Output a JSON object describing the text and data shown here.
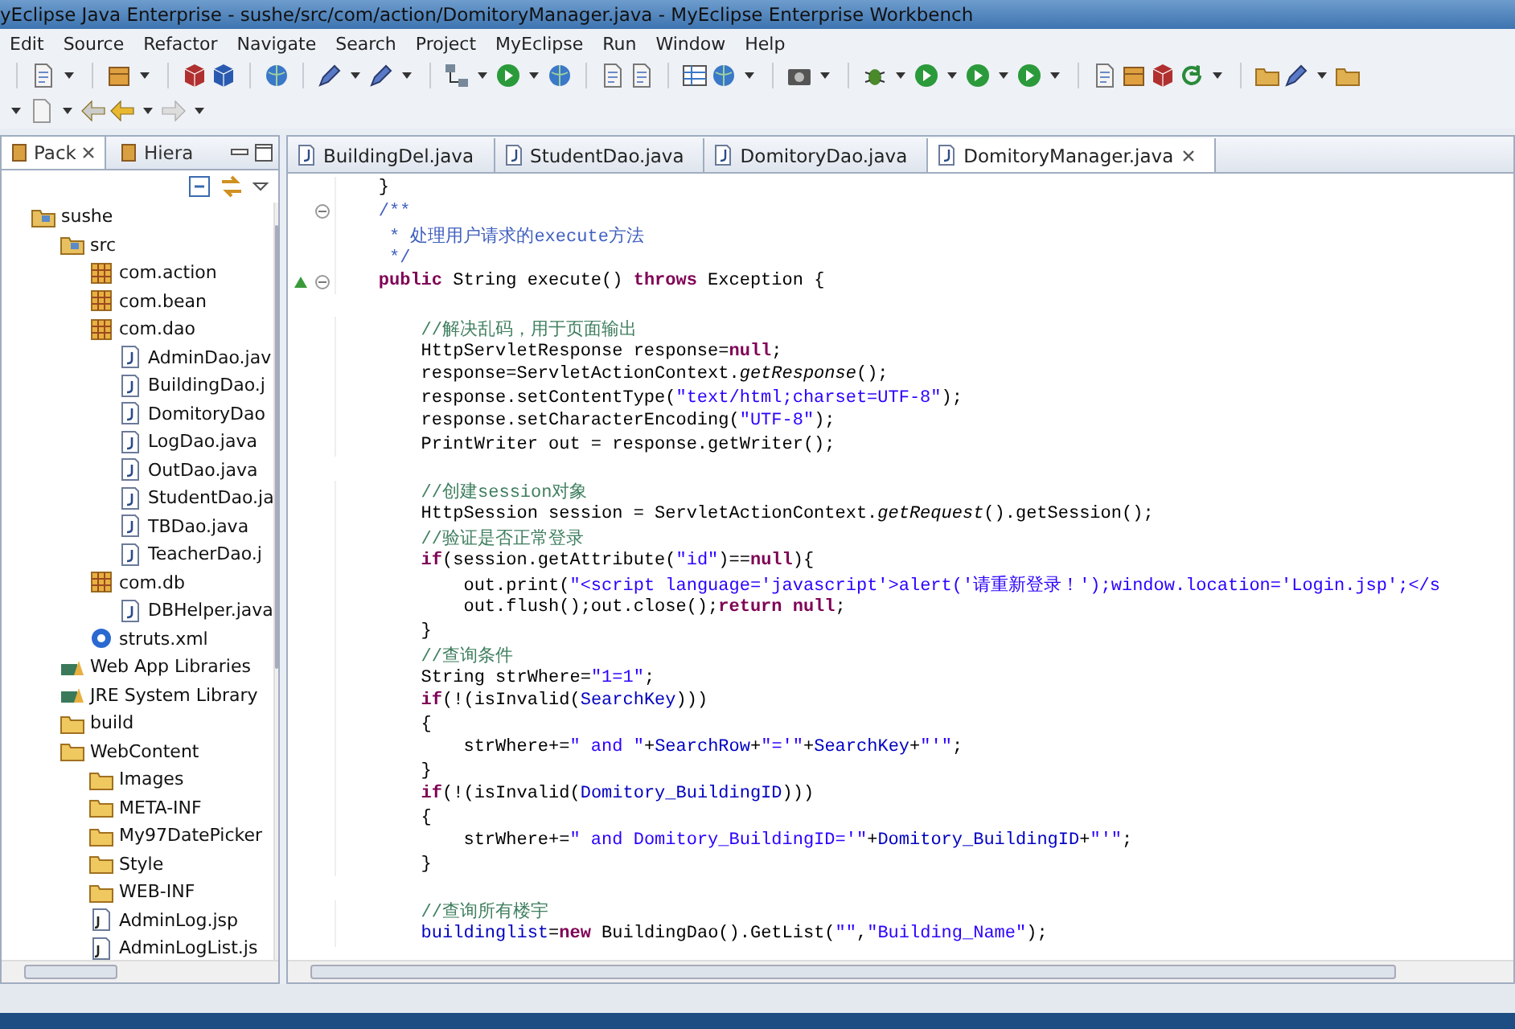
{
  "window": {
    "title": "yEclipse Java Enterprise - sushe/src/com/action/DomitoryManager.java - MyEclipse Enterprise Workbench"
  },
  "menu": [
    "Edit",
    "Source",
    "Refactor",
    "Navigate",
    "Search",
    "Project",
    "MyEclipse",
    "Run",
    "Window",
    "Help"
  ],
  "side_panel": {
    "tabs": [
      {
        "label": "Pack",
        "selected": true
      },
      {
        "label": "Hiera",
        "selected": false
      }
    ],
    "tree": [
      {
        "label": "sushe",
        "kind": "project",
        "children": [
          {
            "label": "src",
            "kind": "srcfolder",
            "children": [
              {
                "label": "com.action",
                "kind": "package"
              },
              {
                "label": "com.bean",
                "kind": "package"
              },
              {
                "label": "com.dao",
                "kind": "package",
                "children": [
                  {
                    "label": "AdminDao.jav",
                    "kind": "java"
                  },
                  {
                    "label": "BuildingDao.j",
                    "kind": "java"
                  },
                  {
                    "label": "DomitoryDao",
                    "kind": "java"
                  },
                  {
                    "label": "LogDao.java",
                    "kind": "java"
                  },
                  {
                    "label": "OutDao.java",
                    "kind": "java"
                  },
                  {
                    "label": "StudentDao.ja",
                    "kind": "java"
                  },
                  {
                    "label": "TBDao.java",
                    "kind": "java"
                  },
                  {
                    "label": "TeacherDao.j",
                    "kind": "java"
                  }
                ]
              },
              {
                "label": "com.db",
                "kind": "package",
                "children": [
                  {
                    "label": "DBHelper.java",
                    "kind": "java"
                  }
                ]
              },
              {
                "label": "struts.xml",
                "kind": "xml"
              }
            ]
          },
          {
            "label": "Web App Libraries",
            "kind": "library"
          },
          {
            "label": "JRE System Library",
            "kind": "library"
          },
          {
            "label": "build",
            "kind": "folder"
          },
          {
            "label": "WebContent",
            "kind": "folder",
            "children": [
              {
                "label": "Images",
                "kind": "folder"
              },
              {
                "label": "META-INF",
                "kind": "folder"
              },
              {
                "label": "My97DatePicker",
                "kind": "folder"
              },
              {
                "label": "Style",
                "kind": "folder"
              },
              {
                "label": "WEB-INF",
                "kind": "folder"
              },
              {
                "label": "AdminLog.jsp",
                "kind": "jsp"
              },
              {
                "label": "AdminLogList.js",
                "kind": "jsp"
              }
            ]
          }
        ]
      }
    ]
  },
  "editor": {
    "tabs": [
      {
        "label": "BuildingDel.java",
        "selected": false
      },
      {
        "label": "StudentDao.java",
        "selected": false
      },
      {
        "label": "DomitoryDao.java",
        "selected": false
      },
      {
        "label": "DomitoryManager.java",
        "selected": true
      }
    ],
    "lines": [
      {
        "tokens": [
          {
            "kind": "plain",
            "text": "    }"
          }
        ]
      },
      {
        "fold": true,
        "tokens": [
          {
            "kind": "doc",
            "text": "    /**"
          }
        ]
      },
      {
        "tokens": [
          {
            "kind": "doc",
            "text": "     * 处理用户请求的execute方法"
          }
        ]
      },
      {
        "tokens": [
          {
            "kind": "doc",
            "text": "     */"
          }
        ]
      },
      {
        "fold": true,
        "override": true,
        "tokens": [
          {
            "kind": "kw",
            "text": "    public"
          },
          {
            "kind": "plain",
            "text": " String execute() "
          },
          {
            "kind": "kw",
            "text": "throws"
          },
          {
            "kind": "plain",
            "text": " Exception {"
          }
        ]
      },
      {
        "gap_before": true,
        "tokens": [
          {
            "kind": "cm",
            "text": "        //解决乱码，用于页面输出"
          }
        ]
      },
      {
        "tokens": [
          {
            "kind": "plain",
            "text": "        HttpServletResponse response="
          },
          {
            "kind": "kw",
            "text": "null"
          },
          {
            "kind": "plain",
            "text": ";"
          }
        ]
      },
      {
        "tokens": [
          {
            "kind": "plain",
            "text": "        response=ServletActionContext."
          },
          {
            "kind": "it",
            "text": "getResponse"
          },
          {
            "kind": "plain",
            "text": "();"
          }
        ]
      },
      {
        "tokens": [
          {
            "kind": "plain",
            "text": "        response.setContentType("
          },
          {
            "kind": "str",
            "text": "\"text/html;charset=UTF-8\""
          },
          {
            "kind": "plain",
            "text": ");"
          }
        ]
      },
      {
        "tokens": [
          {
            "kind": "plain",
            "text": "        response.setCharacterEncoding("
          },
          {
            "kind": "str",
            "text": "\"UTF-8\""
          },
          {
            "kind": "plain",
            "text": ");"
          }
        ]
      },
      {
        "tokens": [
          {
            "kind": "plain",
            "text": "        PrintWriter out = response.getWriter();"
          }
        ]
      },
      {
        "gap_before": true,
        "tokens": [
          {
            "kind": "cm",
            "text": "        //创建session对象"
          }
        ]
      },
      {
        "tokens": [
          {
            "kind": "plain",
            "text": "        HttpSession session = ServletActionContext."
          },
          {
            "kind": "it",
            "text": "getRequest"
          },
          {
            "kind": "plain",
            "text": "().getSession();"
          }
        ]
      },
      {
        "tokens": [
          {
            "kind": "cm",
            "text": "        //验证是否正常登录"
          }
        ]
      },
      {
        "tokens": [
          {
            "kind": "kw",
            "text": "        if"
          },
          {
            "kind": "plain",
            "text": "(session.getAttribute("
          },
          {
            "kind": "str",
            "text": "\"id\""
          },
          {
            "kind": "plain",
            "text": ")=="
          },
          {
            "kind": "kw",
            "text": "null"
          },
          {
            "kind": "plain",
            "text": "){"
          }
        ]
      },
      {
        "tokens": [
          {
            "kind": "plain",
            "text": "            out.print("
          },
          {
            "kind": "str",
            "text": "\"<script language='javascript'>alert('请重新登录！');window.location='Login.jsp';</s"
          }
        ]
      },
      {
        "tokens": [
          {
            "kind": "plain",
            "text": "            out.flush();out.close();"
          },
          {
            "kind": "kw",
            "text": "return null"
          },
          {
            "kind": "plain",
            "text": ";"
          }
        ]
      },
      {
        "tokens": [
          {
            "kind": "plain",
            "text": "        }"
          }
        ]
      },
      {
        "tokens": [
          {
            "kind": "cm",
            "text": "        //查询条件"
          }
        ]
      },
      {
        "tokens": [
          {
            "kind": "plain",
            "text": "        String strWhere="
          },
          {
            "kind": "str",
            "text": "\"1=1\""
          },
          {
            "kind": "plain",
            "text": ";"
          }
        ]
      },
      {
        "tokens": [
          {
            "kind": "kw",
            "text": "        if"
          },
          {
            "kind": "plain",
            "text": "(!(isInvalid("
          },
          {
            "kind": "field",
            "text": "SearchKey"
          },
          {
            "kind": "plain",
            "text": ")))"
          }
        ]
      },
      {
        "tokens": [
          {
            "kind": "plain",
            "text": "        {"
          }
        ]
      },
      {
        "tokens": [
          {
            "kind": "plain",
            "text": "            strWhere+="
          },
          {
            "kind": "str",
            "text": "\" and \""
          },
          {
            "kind": "plain",
            "text": "+"
          },
          {
            "kind": "field",
            "text": "SearchRow"
          },
          {
            "kind": "plain",
            "text": "+"
          },
          {
            "kind": "str",
            "text": "\"='\""
          },
          {
            "kind": "plain",
            "text": "+"
          },
          {
            "kind": "field",
            "text": "SearchKey"
          },
          {
            "kind": "plain",
            "text": "+"
          },
          {
            "kind": "str",
            "text": "\"'\""
          },
          {
            "kind": "plain",
            "text": ";"
          }
        ]
      },
      {
        "tokens": [
          {
            "kind": "plain",
            "text": "        }"
          }
        ]
      },
      {
        "tokens": [
          {
            "kind": "kw",
            "text": "        if"
          },
          {
            "kind": "plain",
            "text": "(!(isInvalid("
          },
          {
            "kind": "field",
            "text": "Domitory_BuildingID"
          },
          {
            "kind": "plain",
            "text": ")))"
          }
        ]
      },
      {
        "tokens": [
          {
            "kind": "plain",
            "text": "        {"
          }
        ]
      },
      {
        "tokens": [
          {
            "kind": "plain",
            "text": "            strWhere+="
          },
          {
            "kind": "str",
            "text": "\" and Domitory_BuildingID='\""
          },
          {
            "kind": "plain",
            "text": "+"
          },
          {
            "kind": "field",
            "text": "Domitory_BuildingID"
          },
          {
            "kind": "plain",
            "text": "+"
          },
          {
            "kind": "str",
            "text": "\"'\""
          },
          {
            "kind": "plain",
            "text": ";"
          }
        ]
      },
      {
        "tokens": [
          {
            "kind": "plain",
            "text": "        }"
          }
        ]
      },
      {
        "gap_before": true,
        "tokens": [
          {
            "kind": "cm",
            "text": "        //查询所有楼宇"
          }
        ]
      },
      {
        "tokens": [
          {
            "kind": "field",
            "text": "        buildinglist"
          },
          {
            "kind": "plain",
            "text": "="
          },
          {
            "kind": "kw",
            "text": "new"
          },
          {
            "kind": "plain",
            "text": " BuildingDao().GetList("
          },
          {
            "kind": "str",
            "text": "\"\""
          },
          {
            "kind": "plain",
            "text": ","
          },
          {
            "kind": "str",
            "text": "\"Building_Name\""
          },
          {
            "kind": "plain",
            "text": ");"
          }
        ]
      }
    ]
  }
}
